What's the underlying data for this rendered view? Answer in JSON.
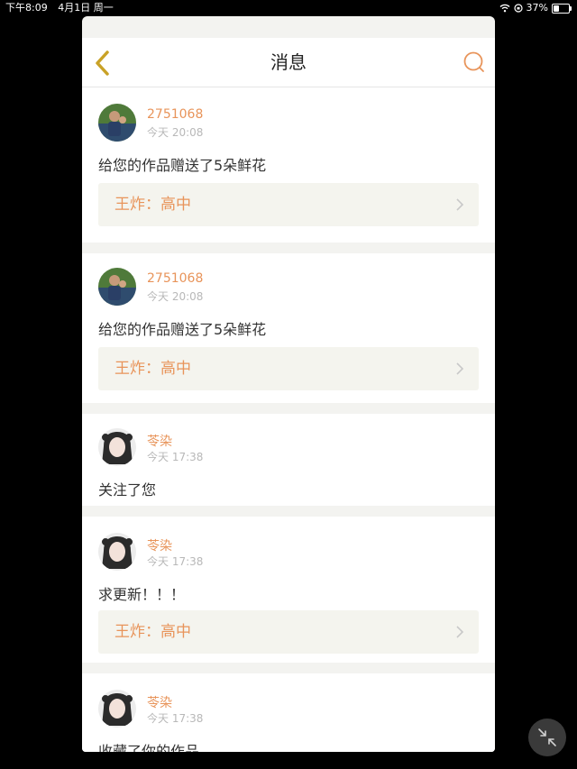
{
  "status_bar": {
    "time": "下午8:09",
    "date": "4月1日 周一",
    "battery_text": "37%",
    "battery_level": 0.37
  },
  "nav": {
    "title": "消息",
    "back_icon": "chevron-left-icon",
    "search_icon": "search-icon"
  },
  "colors": {
    "accent": "#e8945a",
    "back_icon": "#c9a227",
    "ref_bg": "#f4f4ee"
  },
  "messages": [
    {
      "user": "2751068",
      "time": "今天 20:08",
      "text": "给您的作品赠送了5朵鲜花",
      "ref": "王炸：高中",
      "avatar": "photo-avatar-man"
    },
    {
      "user": "2751068",
      "time": "今天 20:08",
      "text": "给您的作品赠送了5朵鲜花",
      "ref": "王炸：高中",
      "avatar": "photo-avatar-man"
    },
    {
      "user": "苓染",
      "time": "今天 17:38",
      "text": "关注了您",
      "avatar": "photo-avatar-girl"
    },
    {
      "user": "苓染",
      "time": "今天 17:38",
      "text": "求更新！！！",
      "ref": "王炸：高中",
      "avatar": "photo-avatar-girl"
    },
    {
      "user": "苓染",
      "time": "今天 17:38",
      "text": "收藏了你的作品",
      "avatar": "photo-avatar-girl"
    }
  ],
  "fab_icon": "collapse-arrows-icon"
}
